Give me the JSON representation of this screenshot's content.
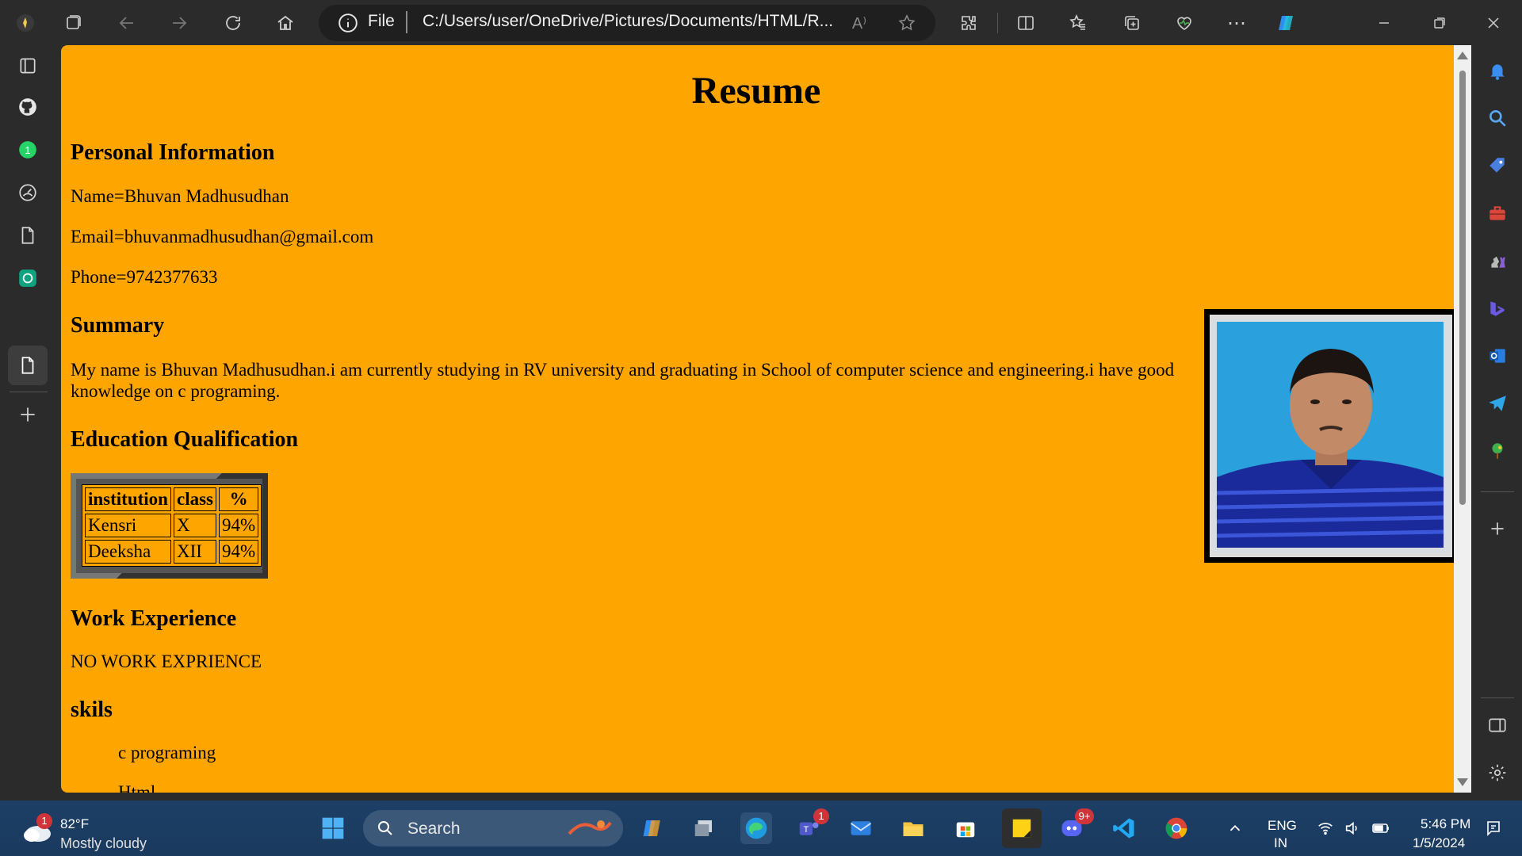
{
  "browser": {
    "site_label": "File",
    "url": "C:/Users/user/OneDrive/Pictures/Documents/HTML/R...",
    "read_aloud_label": "A⁾"
  },
  "page": {
    "title": "Resume",
    "personal_heading": "Personal Information",
    "name_line": "Name=Bhuvan Madhusudhan",
    "email_line": "Email=bhuvanmadhusudhan@gmail.com",
    "phone_line": "Phone=9742377633",
    "summary_heading": "Summary",
    "summary_text": "My name is Bhuvan Madhusudhan.i am currently studying in RV university and graduating in School of computer science and engineering.i have good knowledge on c programing.",
    "education_heading": "Education Qualification",
    "education_table": {
      "headers": [
        "institution",
        "class",
        "%"
      ],
      "rows": [
        [
          "Kensri",
          "X",
          "94%"
        ],
        [
          "Deeksha",
          "XII",
          "94%"
        ]
      ]
    },
    "work_heading": "Work Experience",
    "work_text": "NO WORK EXPRIENCE",
    "skills_heading": "skils",
    "skills": [
      "c programing",
      "Html"
    ]
  },
  "taskbar": {
    "weather_temp": "82°F",
    "weather_desc": "Mostly cloudy",
    "weather_badge": "1",
    "search_label": "Search",
    "teams_badge": "1",
    "discord_badge": "9+",
    "lang_line1": "ENG",
    "lang_line2": "IN",
    "time": "5:46 PM",
    "date": "1/5/2024"
  },
  "colors": {
    "page_background": "#ffa500",
    "chrome_background": "#2b2b2b",
    "taskbar_background": "#1d3f66"
  }
}
